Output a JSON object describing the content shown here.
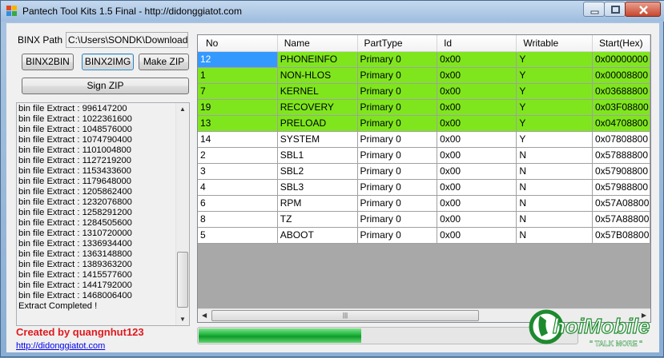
{
  "window": {
    "title": "Pantech Tool Kits 1.5 Final - http://didonggiatot.com"
  },
  "binx": {
    "path_label": "BINX Path",
    "path_value": "C:\\Users\\SONDK\\Downloads"
  },
  "buttons": {
    "binx2bin": "BINX2BIN",
    "binx2img": "BINX2IMG",
    "make_zip": "Make ZIP",
    "sign_zip": "Sign ZIP"
  },
  "log": {
    "lines": [
      "bin file Extract : 996147200",
      "bin file Extract : 1022361600",
      "bin file Extract : 1048576000",
      "bin file Extract : 1074790400",
      "bin file Extract : 1101004800",
      "bin file Extract : 1127219200",
      "bin file Extract : 1153433600",
      "bin file Extract : 1179648000",
      "bin file Extract : 1205862400",
      "bin file Extract : 1232076800",
      "bin file Extract : 1258291200",
      "bin file Extract : 1284505600",
      "bin file Extract : 1310720000",
      "bin file Extract : 1336934400",
      "bin file Extract : 1363148800",
      "bin file Extract : 1389363200",
      "bin file Extract : 1415577600",
      "bin file Extract : 1441792000",
      "bin file Extract : 1468006400",
      "Extract Completed !"
    ]
  },
  "footer": {
    "credit": "Created by quangnhut123",
    "link": "http://didonggiatot.com"
  },
  "table": {
    "columns": [
      "No",
      "Name",
      "PartType",
      "Id",
      "Writable",
      "Start(Hex)"
    ],
    "rows": [
      {
        "cells": [
          "12",
          "PHONEINFO",
          "Primary 0",
          "0x00",
          "Y",
          "0x00000000"
        ],
        "highlight": true,
        "selected": true
      },
      {
        "cells": [
          "1",
          "NON-HLOS",
          "Primary 0",
          "0x00",
          "Y",
          "0x00008800"
        ],
        "highlight": true,
        "selected": false
      },
      {
        "cells": [
          "7",
          "KERNEL",
          "Primary 0",
          "0x00",
          "Y",
          "0x03688800"
        ],
        "highlight": true,
        "selected": false
      },
      {
        "cells": [
          "19",
          "RECOVERY",
          "Primary 0",
          "0x00",
          "Y",
          "0x03F08800"
        ],
        "highlight": true,
        "selected": false
      },
      {
        "cells": [
          "13",
          "PRELOAD",
          "Primary 0",
          "0x00",
          "Y",
          "0x04708800"
        ],
        "highlight": true,
        "selected": false
      },
      {
        "cells": [
          "14",
          "SYSTEM",
          "Primary 0",
          "0x00",
          "Y",
          "0x07808800"
        ],
        "highlight": false,
        "selected": false
      },
      {
        "cells": [
          "2",
          "SBL1",
          "Primary 0",
          "0x00",
          "N",
          "0x57888800"
        ],
        "highlight": false,
        "selected": false
      },
      {
        "cells": [
          "3",
          "SBL2",
          "Primary 0",
          "0x00",
          "N",
          "0x57908800"
        ],
        "highlight": false,
        "selected": false
      },
      {
        "cells": [
          "4",
          "SBL3",
          "Primary 0",
          "0x00",
          "N",
          "0x57988800"
        ],
        "highlight": false,
        "selected": false
      },
      {
        "cells": [
          "6",
          "RPM",
          "Primary 0",
          "0x00",
          "N",
          "0x57A08800"
        ],
        "highlight": false,
        "selected": false
      },
      {
        "cells": [
          "8",
          "TZ",
          "Primary 0",
          "0x00",
          "N",
          "0x57A88800"
        ],
        "highlight": false,
        "selected": false
      },
      {
        "cells": [
          "5",
          "ABOOT",
          "Primary 0",
          "0x00",
          "N",
          "0x57B08800"
        ],
        "highlight": false,
        "selected": false
      }
    ]
  },
  "progress": {
    "fraction": 0.43
  },
  "watermark": {
    "brand": "ChoiMobile",
    "tagline": "TALK MORE"
  },
  "colors": {
    "row_highlight": "#7fe61e",
    "selection": "#3399ff",
    "credit_red": "#e0191e",
    "progress_green": "#1cb33a"
  }
}
